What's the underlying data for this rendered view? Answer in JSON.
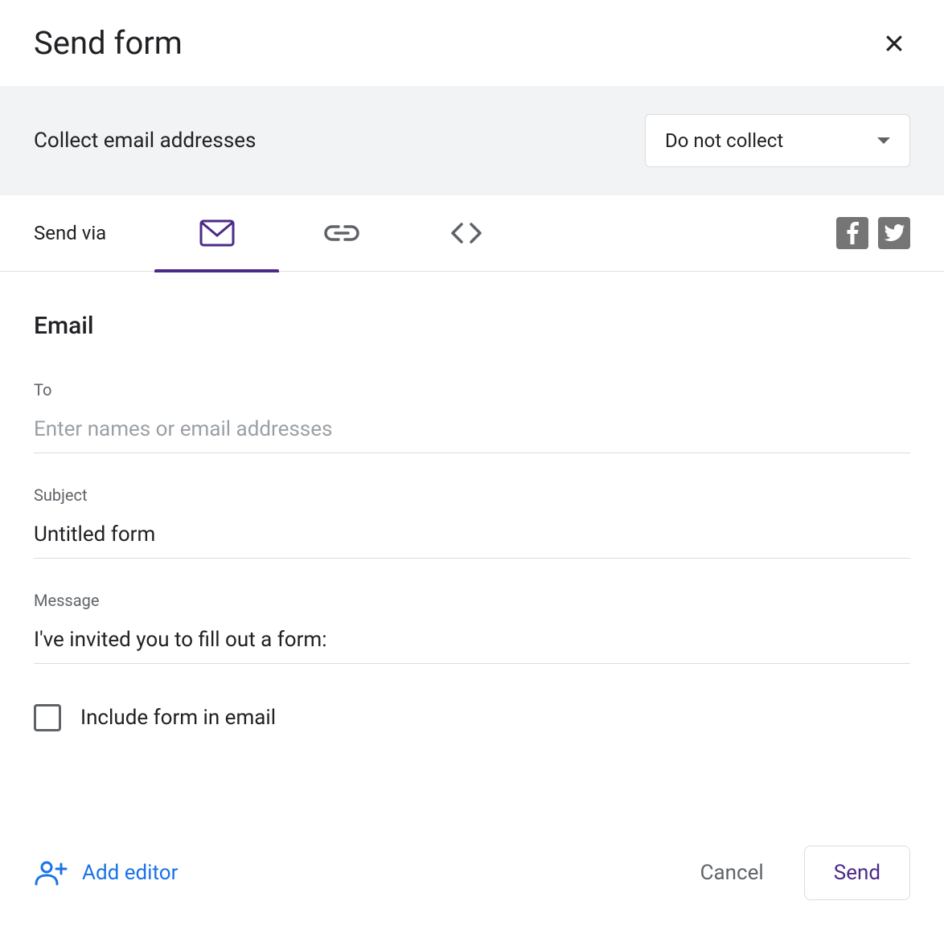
{
  "dialog": {
    "title": "Send form"
  },
  "collect": {
    "label": "Collect email addresses",
    "selected": "Do not collect"
  },
  "tabs": {
    "label": "Send via"
  },
  "email": {
    "heading": "Email",
    "to_label": "To",
    "to_placeholder": "Enter names or email addresses",
    "to_value": "",
    "subject_label": "Subject",
    "subject_value": "Untitled form",
    "message_label": "Message",
    "message_value": "I've invited you to fill out a form:",
    "include_label": "Include form in email"
  },
  "footer": {
    "add_editor": "Add editor",
    "cancel": "Cancel",
    "send": "Send"
  }
}
